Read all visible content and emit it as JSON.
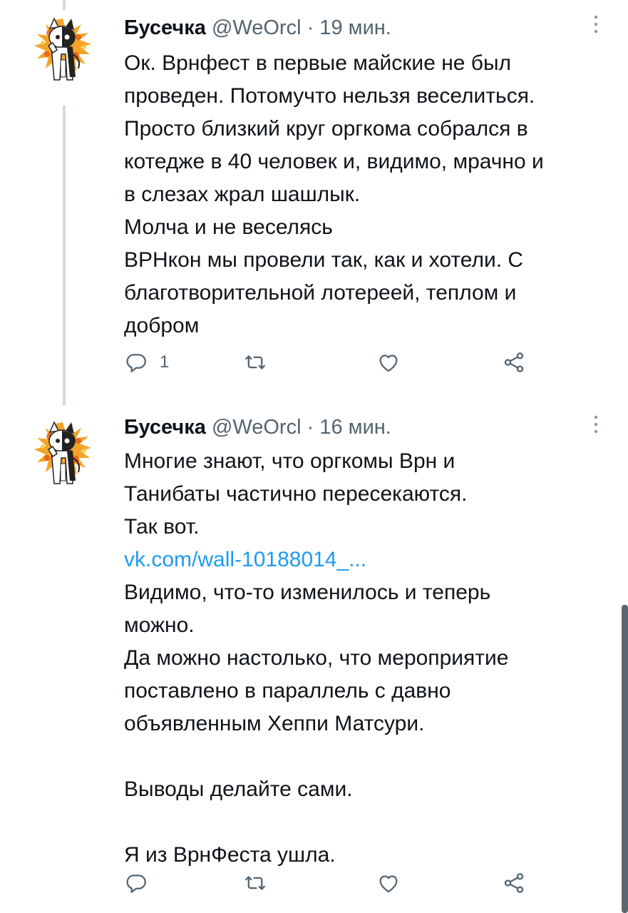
{
  "tweets": [
    {
      "author_name": "Бусечка",
      "author_handle": "@WeOrcl",
      "separator": "·",
      "time": "19 мин.",
      "lines": [
        "Ок. Врнфест в первые майские не был",
        "проведен. Потомучто нельзя веселиться.",
        "Просто близкий круг оргкома собрался в",
        "котедже в 40 человек и, видимо, мрачно и",
        "в слезах жрал шашлык.",
        "Молча и не веселясь",
        "ВРНкон мы провели так, как и хотели. С",
        "благотворительной лотереей, теплом и",
        "добром"
      ],
      "reply_count": "1"
    },
    {
      "author_name": "Бусечка",
      "author_handle": "@WeOrcl",
      "separator": "·",
      "time": "16 мин.",
      "lines": [
        "Многие знают, что оргкомы Врн и",
        "Танибаты частично пересекаются.",
        "Так вот.",
        "vk.com/wall-10188014_...",
        "Видимо, что-то изменилось и теперь",
        "можно.",
        "Да можно настолько, что мероприятие",
        "поставлено в параллель с давно",
        "объявленным Хеппи Матсури.",
        "",
        "Выводы делайте сами.",
        "",
        "Я из ВрнФеста ушла."
      ],
      "reply_count": ""
    }
  ],
  "icons": {
    "reply": "reply-icon",
    "retweet": "retweet-icon",
    "like": "heart-icon",
    "share": "share-icon",
    "more": "more-vertical-icon"
  },
  "colors": {
    "text": "#0f1419",
    "secondary": "#536471",
    "link": "#1d9bf0",
    "thread_line": "#cfd9de",
    "avatar_orange": "#f29b1d"
  }
}
